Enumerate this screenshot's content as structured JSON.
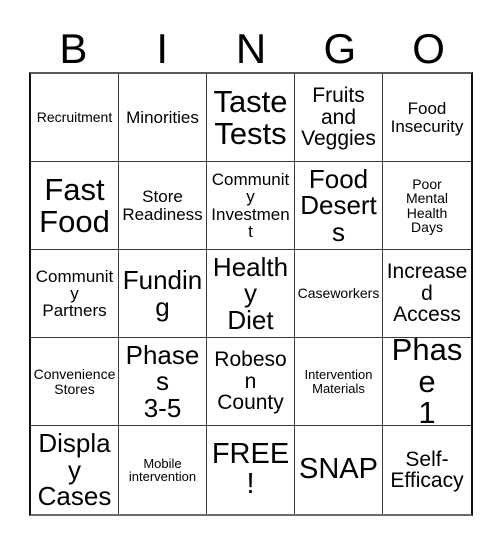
{
  "card": {
    "title": "BINGO",
    "header_letters": [
      "B",
      "I",
      "N",
      "G",
      "O"
    ],
    "grid": {
      "columns": 5,
      "rows": 5,
      "free_space_label": "FREE!",
      "free_space_position": "row5-col3"
    },
    "cells": [
      {
        "text": "Recruitment",
        "size": "xs"
      },
      {
        "text": "Minorities",
        "size": "sm"
      },
      {
        "text": "Taste\nTests",
        "size": "xxl"
      },
      {
        "text": "Fruits\nand\nVeggies",
        "size": "md"
      },
      {
        "text": "Food\nInsecurity",
        "size": "sm"
      },
      {
        "text": "Fast\nFood",
        "size": "xxl"
      },
      {
        "text": "Store\nReadiness",
        "size": "sm"
      },
      {
        "text": "Community\nInvestment",
        "size": "sm"
      },
      {
        "text": "Food\nDeserts",
        "size": "lg"
      },
      {
        "text": "Poor\nMental\nHealth\nDays",
        "size": "xs"
      },
      {
        "text": "Community\nPartners",
        "size": "sm"
      },
      {
        "text": "Funding",
        "size": "lg"
      },
      {
        "text": "Healthy\nDiet",
        "size": "lg"
      },
      {
        "text": "Caseworkers",
        "size": "xs"
      },
      {
        "text": "Increased\nAccess",
        "size": "md"
      },
      {
        "text": "Convenience\nStores",
        "size": "xs"
      },
      {
        "text": "Phases\n3-5",
        "size": "lg"
      },
      {
        "text": "Robeson\nCounty",
        "size": "md"
      },
      {
        "text": "Intervention\nMaterials",
        "size": "xxs"
      },
      {
        "text": "Phase\n1",
        "size": "xxl"
      },
      {
        "text": "Display\nCases",
        "size": "lg"
      },
      {
        "text": "Mobile\nintervention",
        "size": "xxs"
      },
      {
        "text": "FREE!",
        "size": "xl"
      },
      {
        "text": "SNAP",
        "size": "xl"
      },
      {
        "text": "Self-\nEfficacy",
        "size": "md"
      }
    ]
  },
  "colors": {
    "background": "#ffffff",
    "text": "#000000",
    "grid_line": "#3a3a3a",
    "border": "#111111"
  }
}
